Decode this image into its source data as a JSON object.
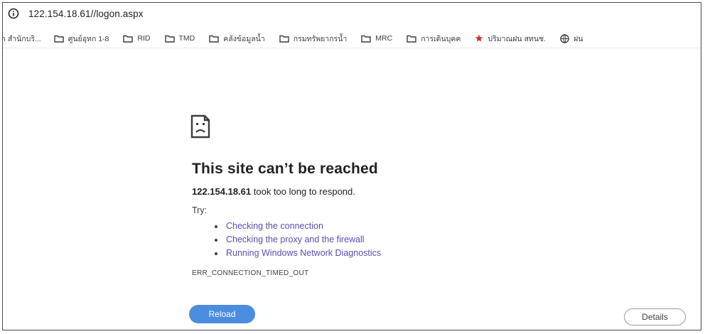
{
  "browser": {
    "url": "122.154.18.61//logon.aspx"
  },
  "bookmarks": [
    {
      "label": "า สำนักบริ...",
      "icon": "none"
    },
    {
      "label": "ศูนย์อุทก 1-8",
      "icon": "folder-icon"
    },
    {
      "label": "RID",
      "icon": "folder-icon"
    },
    {
      "label": "TMD",
      "icon": "folder-icon"
    },
    {
      "label": "คลังข้อมูลน้ำ",
      "icon": "folder-icon"
    },
    {
      "label": "กรมทรัพยากรน้ำ",
      "icon": "folder-icon"
    },
    {
      "label": "MRC",
      "icon": "folder-icon"
    },
    {
      "label": "การเดินบุคค",
      "icon": "folder-icon"
    },
    {
      "label": "ปริมาณฝน สทนช.",
      "icon": "red-star-icon"
    },
    {
      "label": "ฝน",
      "icon": "globe-icon"
    }
  ],
  "error_page": {
    "heading": "This site can’t be reached",
    "host": "122.154.18.61",
    "message": "took too long to respond.",
    "try_label": "Try:",
    "suggestions": [
      "Checking the connection",
      "Checking the proxy and the firewall",
      "Running Windows Network Diagnostics"
    ],
    "error_code": "ERR_CONNECTION_TIMED_OUT",
    "reload_label": "Reload",
    "details_label": "Details"
  },
  "colors": {
    "link": "#5a4fb0",
    "reload_button": "#4a8ddf",
    "text": "#202124"
  }
}
